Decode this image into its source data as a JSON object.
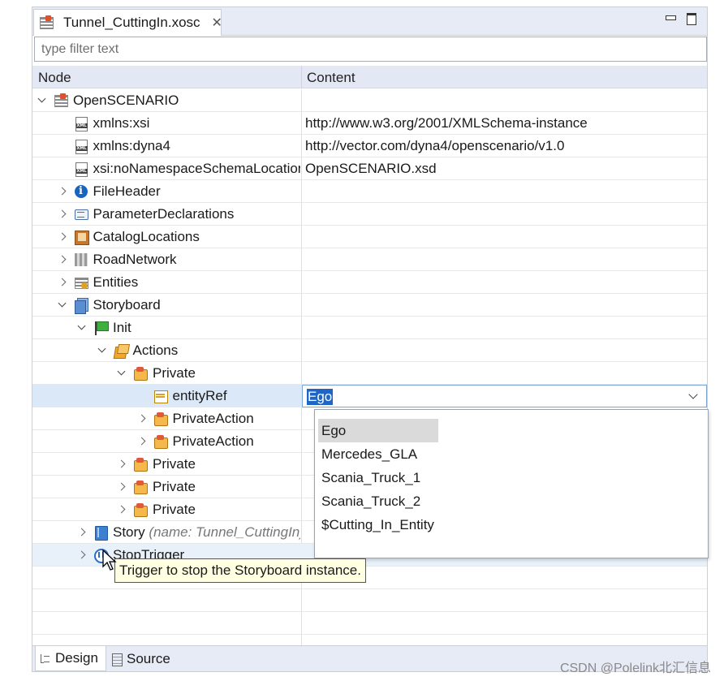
{
  "editor": {
    "tab_title": "Tunnel_CuttingIn.xosc",
    "close_glyph": "✕"
  },
  "filter": {
    "placeholder": "type filter text",
    "value": ""
  },
  "columns": {
    "node": "Node",
    "content": "Content"
  },
  "tree": [
    {
      "label": "OpenSCENARIO",
      "content": "",
      "icon": "scenario-icon",
      "expand": "expanded",
      "depth": 0
    },
    {
      "label": "xmlns:xsi",
      "content": "http://www.w3.org/2001/XMLSchema-instance",
      "icon": "xml-attribute-icon",
      "expand": "none",
      "depth": 1
    },
    {
      "label": "xmlns:dyna4",
      "content": "http://vector.com/dyna4/openscenario/v1.0",
      "icon": "xml-attribute-icon",
      "expand": "none",
      "depth": 1
    },
    {
      "label": "xsi:noNamespaceSchemaLocation",
      "content": "OpenSCENARIO.xsd",
      "icon": "xml-attribute-icon",
      "expand": "none",
      "depth": 1
    },
    {
      "label": "FileHeader",
      "content": "",
      "icon": "info-icon",
      "expand": "collapsed",
      "depth": 1
    },
    {
      "label": "ParameterDeclarations",
      "content": "",
      "icon": "parameters-icon",
      "expand": "collapsed",
      "depth": 1
    },
    {
      "label": "CatalogLocations",
      "content": "",
      "icon": "catalog-icon",
      "expand": "collapsed",
      "depth": 1
    },
    {
      "label": "RoadNetwork",
      "content": "",
      "icon": "road-network-icon",
      "expand": "collapsed",
      "depth": 1
    },
    {
      "label": "Entities",
      "content": "",
      "icon": "entities-icon",
      "expand": "collapsed",
      "depth": 1
    },
    {
      "label": "Storyboard",
      "content": "",
      "icon": "storyboard-icon",
      "expand": "expanded",
      "depth": 1
    },
    {
      "label": "Init",
      "content": "",
      "icon": "init-flag-icon",
      "expand": "expanded",
      "depth": 2
    },
    {
      "label": "Actions",
      "content": "",
      "icon": "actions-icon",
      "expand": "expanded",
      "depth": 3
    },
    {
      "label": "Private",
      "content": "",
      "icon": "private-icon",
      "expand": "expanded",
      "depth": 4
    },
    {
      "label": "entityRef",
      "content": "Ego",
      "icon": "entity-ref-icon",
      "expand": "none",
      "depth": 5,
      "selected": true
    },
    {
      "label": "PrivateAction",
      "content": "",
      "icon": "private-icon",
      "expand": "collapsed",
      "depth": 5
    },
    {
      "label": "PrivateAction",
      "content": "",
      "icon": "private-icon",
      "expand": "collapsed",
      "depth": 5
    },
    {
      "label": "Private",
      "content": "",
      "icon": "private-icon",
      "expand": "collapsed",
      "depth": 4
    },
    {
      "label": "Private",
      "content": "",
      "icon": "private-icon",
      "expand": "collapsed",
      "depth": 4
    },
    {
      "label": "Private",
      "content": "",
      "icon": "private-icon",
      "expand": "collapsed",
      "depth": 4
    },
    {
      "label": "Story",
      "meta": "(name: Tunnel_CuttingIn)",
      "content": "",
      "icon": "story-icon",
      "expand": "collapsed",
      "depth": 2
    },
    {
      "label": "StopTrigger",
      "content": "",
      "icon": "stop-trigger-icon",
      "expand": "collapsed",
      "depth": 2,
      "hover": true
    }
  ],
  "entity_dropdown": {
    "selected": "Ego",
    "options": [
      "Ego",
      "Mercedes_GLA",
      "Scania_Truck_1",
      "Scania_Truck_2",
      "$Cutting_In_Entity"
    ]
  },
  "tooltip": "Trigger to stop the Storyboard instance.",
  "bottom_tabs": {
    "design": "Design",
    "source": "Source"
  },
  "watermark": "CSDN @Polelink北汇信息"
}
